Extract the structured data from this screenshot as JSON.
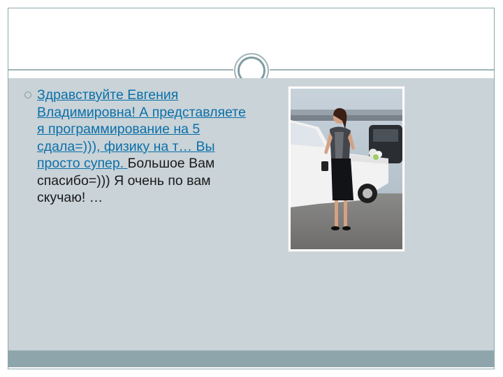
{
  "slide": {
    "bullet": {
      "link_text": "Здравствуйте Евгения Владимировна! А представляете я программирование на 5 сдала=))), физику на т… Вы просто супер. ",
      "plain_text": "Большое Вам спасибо=))) Я очень по вам скучаю! …"
    },
    "colors": {
      "link": "#0b6fa8",
      "content_background": "#c9d3d8",
      "footer": "#8ea6ab",
      "accent": "#7f9ba2"
    }
  }
}
